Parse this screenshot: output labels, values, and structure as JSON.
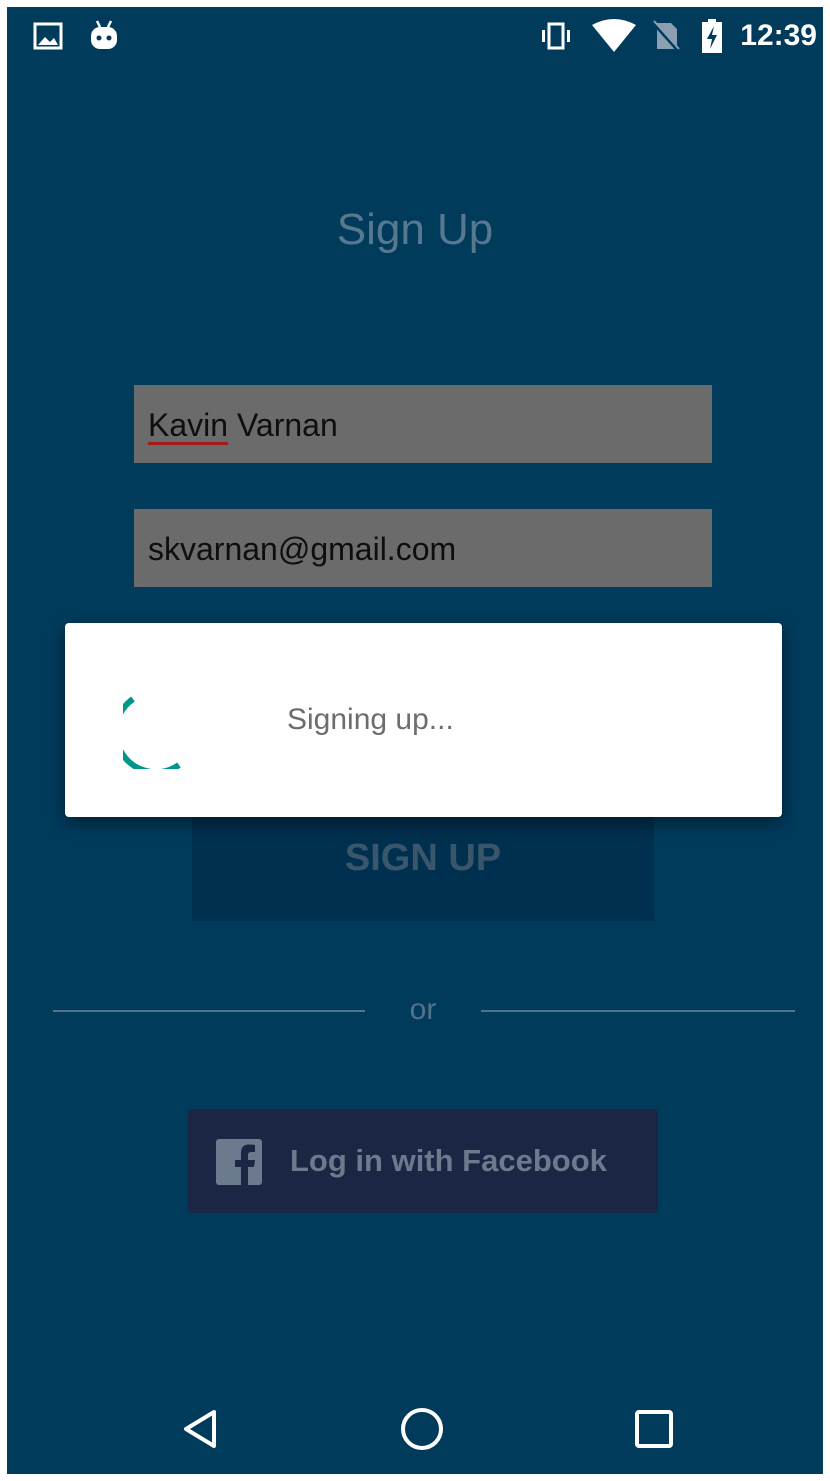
{
  "status_bar": {
    "time": "12:39",
    "icons": [
      "image-notification-icon",
      "android-debug-icon",
      "vibrate-icon",
      "wifi-icon",
      "no-sim-icon",
      "battery-charging-icon"
    ]
  },
  "page": {
    "title": "Sign Up",
    "name_field": {
      "value_first": "Kavin",
      "value_rest": " Varnan"
    },
    "email_field": {
      "value": "skvarnan@gmail.com"
    },
    "signup_button": "SIGN UP",
    "divider_text": "or",
    "facebook_button": "Log in with Facebook"
  },
  "dialog": {
    "message": "Signing up...",
    "spinner_color": "#009688"
  },
  "colors": {
    "background": "#003b5c",
    "field": "#6b6b6b",
    "facebook_button": "#1a2644"
  },
  "nav_bar": {
    "buttons": [
      "back-icon",
      "home-icon",
      "recents-icon"
    ]
  }
}
